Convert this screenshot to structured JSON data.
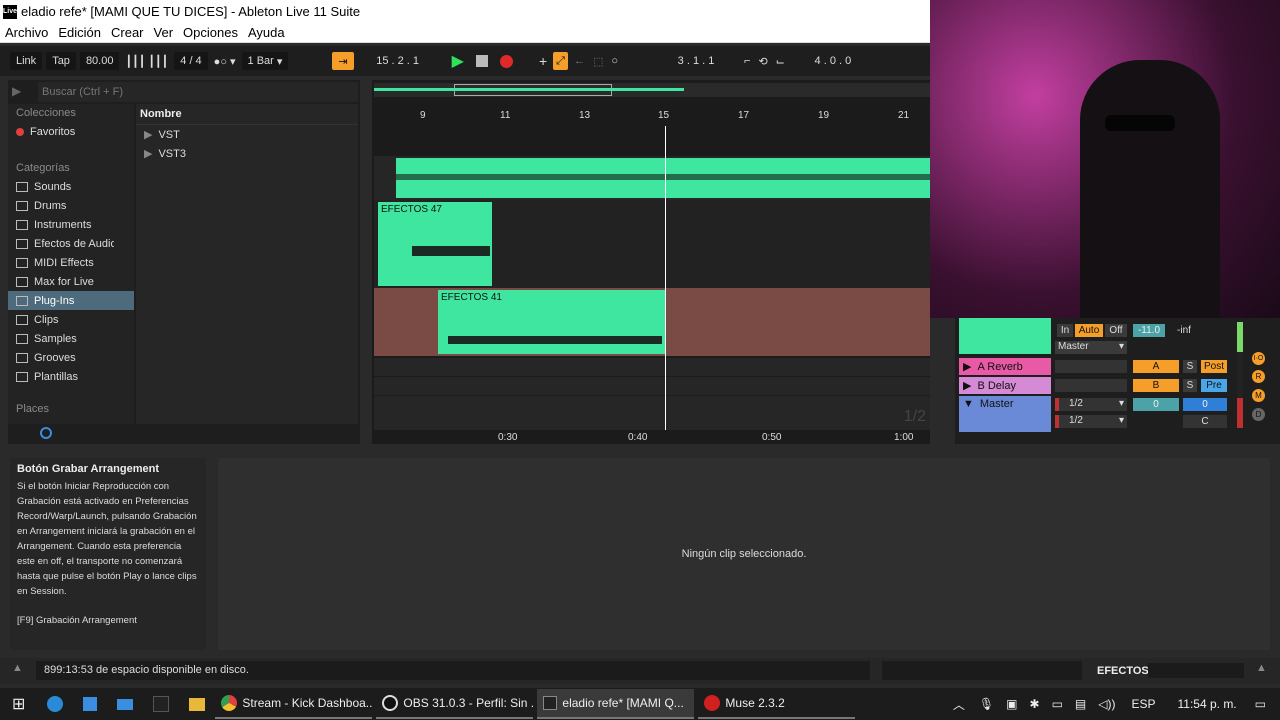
{
  "window": {
    "title": "eladio refe*  [MAMI QUE TU DICES] - Ableton Live 11 Suite",
    "logo": "Live"
  },
  "menu": [
    "Archivo",
    "Edición",
    "Crear",
    "Ver",
    "Opciones",
    "Ayuda"
  ],
  "transport": {
    "link": "Link",
    "tap": "Tap",
    "tempo": "80.00",
    "signature": "4 / 4",
    "quant": "1 Bar",
    "position": "15 .  2 .  1",
    "loop_start": "3 .  1 .  1",
    "loop_length": "4 .  0 .  0"
  },
  "browser": {
    "search_placeholder": "Buscar (Ctrl + F)",
    "collections_label": "Colecciones",
    "favorites": "Favoritos",
    "categories_label": "Categorías",
    "categories": [
      "Sounds",
      "Drums",
      "Instruments",
      "Efectos de Audio",
      "MIDI Effects",
      "Max for Live",
      "Plug-Ins",
      "Clips",
      "Samples",
      "Grooves",
      "Plantillas"
    ],
    "selected_category": "Plug-Ins",
    "places_label": "Places",
    "column_header": "Nombre",
    "items": [
      "VST",
      "VST3"
    ]
  },
  "arrangement": {
    "bar_markers": [
      "9",
      "11",
      "13",
      "15",
      "17",
      "19",
      "21"
    ],
    "time_markers": [
      "0:30",
      "0:40",
      "0:50",
      "1:00"
    ],
    "clip1": "EFECTOS 47",
    "clip2": "EFECTOS 41",
    "overlay_text": "1/2"
  },
  "mixer": {
    "in": "In",
    "auto": "Auto",
    "off": "Off",
    "volume": "-11.0",
    "peak": "-inf",
    "output": "Master",
    "return_a": "A Reverb",
    "return_b": "B Delay",
    "master": "Master",
    "send_a": "A",
    "send_b": "B",
    "s": "S",
    "post": "Post",
    "pre": "Pre",
    "ratio1": "1/2",
    "ratio2": "1/2",
    "vol_a": "0",
    "vol_b": "0",
    "pan": "C",
    "side_labels": [
      "I·O",
      "R",
      "M",
      "D"
    ]
  },
  "info": {
    "title": "Botón Grabar Arrangement",
    "body": "Si el botón Iniciar Reproducción con Grabación está activado en Preferencias Record/Warp/Launch, pulsando Grabación en Arrangement iniciará la grabación en el Arrangement. Cuando esta preferencia este en off, el transporte no comenzará hasta que pulse el botón Play o lance clips en Session.",
    "shortcut": "[F9] Grabación Arrangement"
  },
  "detail": {
    "message": "Ningún clip seleccionado."
  },
  "status": {
    "message": "899:13:53 de espacio disponible en disco.",
    "track": "EFECTOS"
  },
  "taskbar": {
    "tasks": [
      "Stream - Kick Dashboa...",
      "OBS 31.0.3 - Perfil: Sin ...",
      "eladio refe*  [MAMI Q...",
      "Muse 2.3.2"
    ],
    "lang": "ESP",
    "time": "11:54 p. m."
  }
}
